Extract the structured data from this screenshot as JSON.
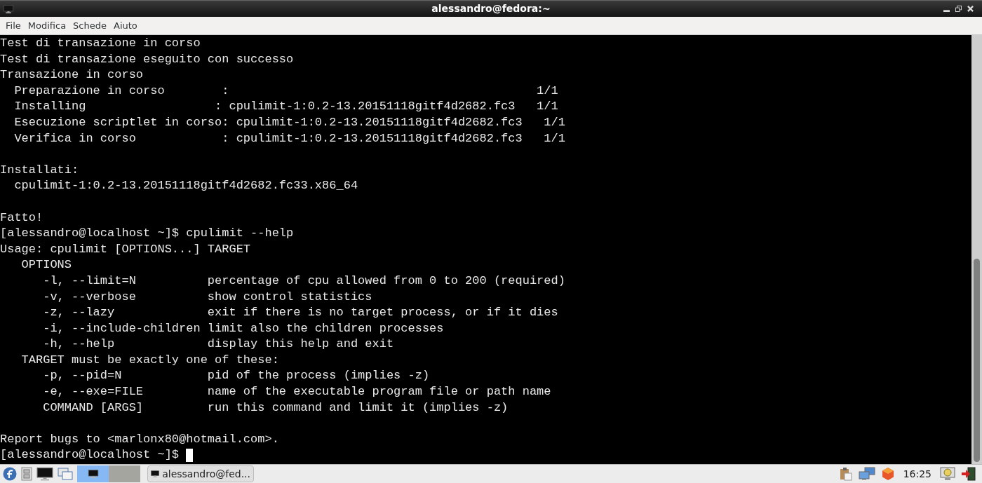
{
  "window": {
    "title": "alessandro@fedora:~"
  },
  "menu": [
    "File",
    "Modifica",
    "Schede",
    "Aiuto"
  ],
  "terminal": {
    "lines": [
      {
        "kind": "text",
        "text": "Test di transazione in corso"
      },
      {
        "kind": "text",
        "text": "Test di transazione eseguito con successo"
      },
      {
        "kind": "text",
        "text": "Transazione in corso"
      },
      {
        "kind": "text",
        "text": "  Preparazione in corso        :                                           1/1"
      },
      {
        "kind": "text",
        "text": "  Installing                  : cpulimit-1:0.2-13.20151118gitf4d2682.fc3   1/1"
      },
      {
        "kind": "text",
        "text": "  Esecuzione scriptlet in corso: cpulimit-1:0.2-13.20151118gitf4d2682.fc3   1/1"
      },
      {
        "kind": "text",
        "text": "  Verifica in corso            : cpulimit-1:0.2-13.20151118gitf4d2682.fc3   1/1"
      },
      {
        "kind": "blank"
      },
      {
        "kind": "text",
        "text": "Installati:"
      },
      {
        "kind": "text",
        "text": "  cpulimit-1:0.2-13.20151118gitf4d2682.fc33.x86_64"
      },
      {
        "kind": "blank"
      },
      {
        "kind": "text",
        "text": "Fatto!"
      },
      {
        "kind": "text",
        "text": "[alessandro@localhost ~]$ cpulimit --help"
      },
      {
        "kind": "text",
        "text": "Usage: cpulimit [OPTIONS...] TARGET"
      },
      {
        "kind": "text",
        "text": "   OPTIONS"
      },
      {
        "kind": "text",
        "text": "      -l, --limit=N          percentage of cpu allowed from 0 to 200 (required)"
      },
      {
        "kind": "text",
        "text": "      -v, --verbose          show control statistics"
      },
      {
        "kind": "text",
        "text": "      -z, --lazy             exit if there is no target process, or if it dies"
      },
      {
        "kind": "text",
        "text": "      -i, --include-children limit also the children processes"
      },
      {
        "kind": "text",
        "text": "      -h, --help             display this help and exit"
      },
      {
        "kind": "text",
        "text": "   TARGET must be exactly one of these:"
      },
      {
        "kind": "text",
        "text": "      -p, --pid=N            pid of the process (implies -z)"
      },
      {
        "kind": "text",
        "text": "      -e, --exe=FILE         name of the executable program file or path name"
      },
      {
        "kind": "text",
        "text": "      COMMAND [ARGS]         run this command and limit it (implies -z)"
      },
      {
        "kind": "blank"
      },
      {
        "kind": "text",
        "text": "Report bugs to <marlonx80@hotmail.com>."
      },
      {
        "kind": "prompt",
        "text": "[alessandro@localhost ~]$ "
      }
    ]
  },
  "taskbar": {
    "workspaces": [
      {
        "selected": true
      },
      {
        "selected": false
      }
    ],
    "tasks": [
      "alessandro@fed..."
    ],
    "clock": "16:25"
  }
}
